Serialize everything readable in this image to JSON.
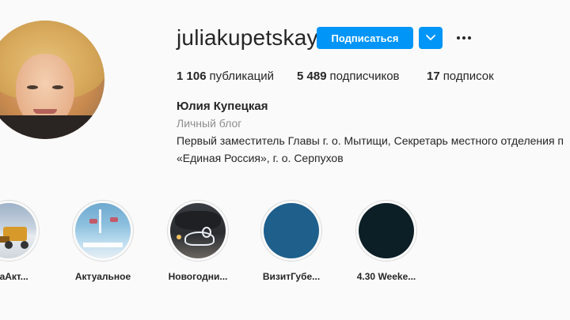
{
  "profile": {
    "username": "juliakupetskaya",
    "follow_label": "Подписаться",
    "full_name": "Юлия Купецкая",
    "category": "Личный блог",
    "bio_line1": "Первый заместитель Главы г. о. Мытищи, Секретарь местного отделения п",
    "bio_line2": "«Единая Россия», г. о. Серпухов"
  },
  "stats": [
    {
      "value": "1 106",
      "label": "публикаций"
    },
    {
      "value": "5 489",
      "label": "подписчиков"
    },
    {
      "value": "17",
      "label": "подписок"
    }
  ],
  "highlights": [
    {
      "label": "ркаАкт..."
    },
    {
      "label": "Актуальное"
    },
    {
      "label": "Новогодни..."
    },
    {
      "label": "ВизитГубе..."
    },
    {
      "label": "4.30 Weeke..."
    }
  ],
  "colors": {
    "accent": "#0095f6",
    "highlight_4": "#1e5f8c",
    "highlight_5": "#0c1e26"
  }
}
